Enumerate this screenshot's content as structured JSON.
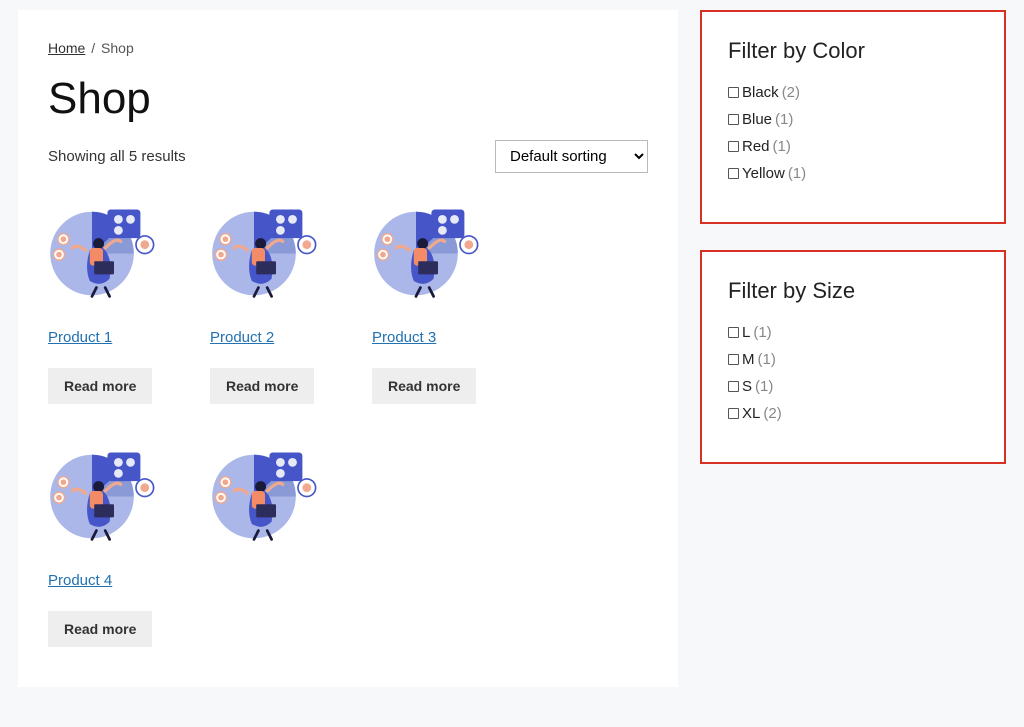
{
  "breadcrumb": {
    "home": "Home",
    "current": "Shop"
  },
  "page_title": "Shop",
  "result_count": "Showing all 5 results",
  "sort_selected": "Default sorting",
  "products": [
    {
      "title": "Product 1",
      "button": "Read more"
    },
    {
      "title": "Product 2",
      "button": "Read more"
    },
    {
      "title": "Product 3",
      "button": "Read more"
    },
    {
      "title": "Product 4",
      "button": "Read more"
    },
    {
      "title": "",
      "button": ""
    }
  ],
  "filters": {
    "color": {
      "title": "Filter by Color",
      "items": [
        {
          "label": "Black",
          "count": "(2)"
        },
        {
          "label": "Blue",
          "count": "(1)"
        },
        {
          "label": "Red",
          "count": "(1)"
        },
        {
          "label": "Yellow",
          "count": "(1)"
        }
      ]
    },
    "size": {
      "title": "Filter by Size",
      "items": [
        {
          "label": "L",
          "count": "(1)"
        },
        {
          "label": "M",
          "count": "(1)"
        },
        {
          "label": "S",
          "count": "(1)"
        },
        {
          "label": "XL",
          "count": "(2)"
        }
      ]
    }
  }
}
